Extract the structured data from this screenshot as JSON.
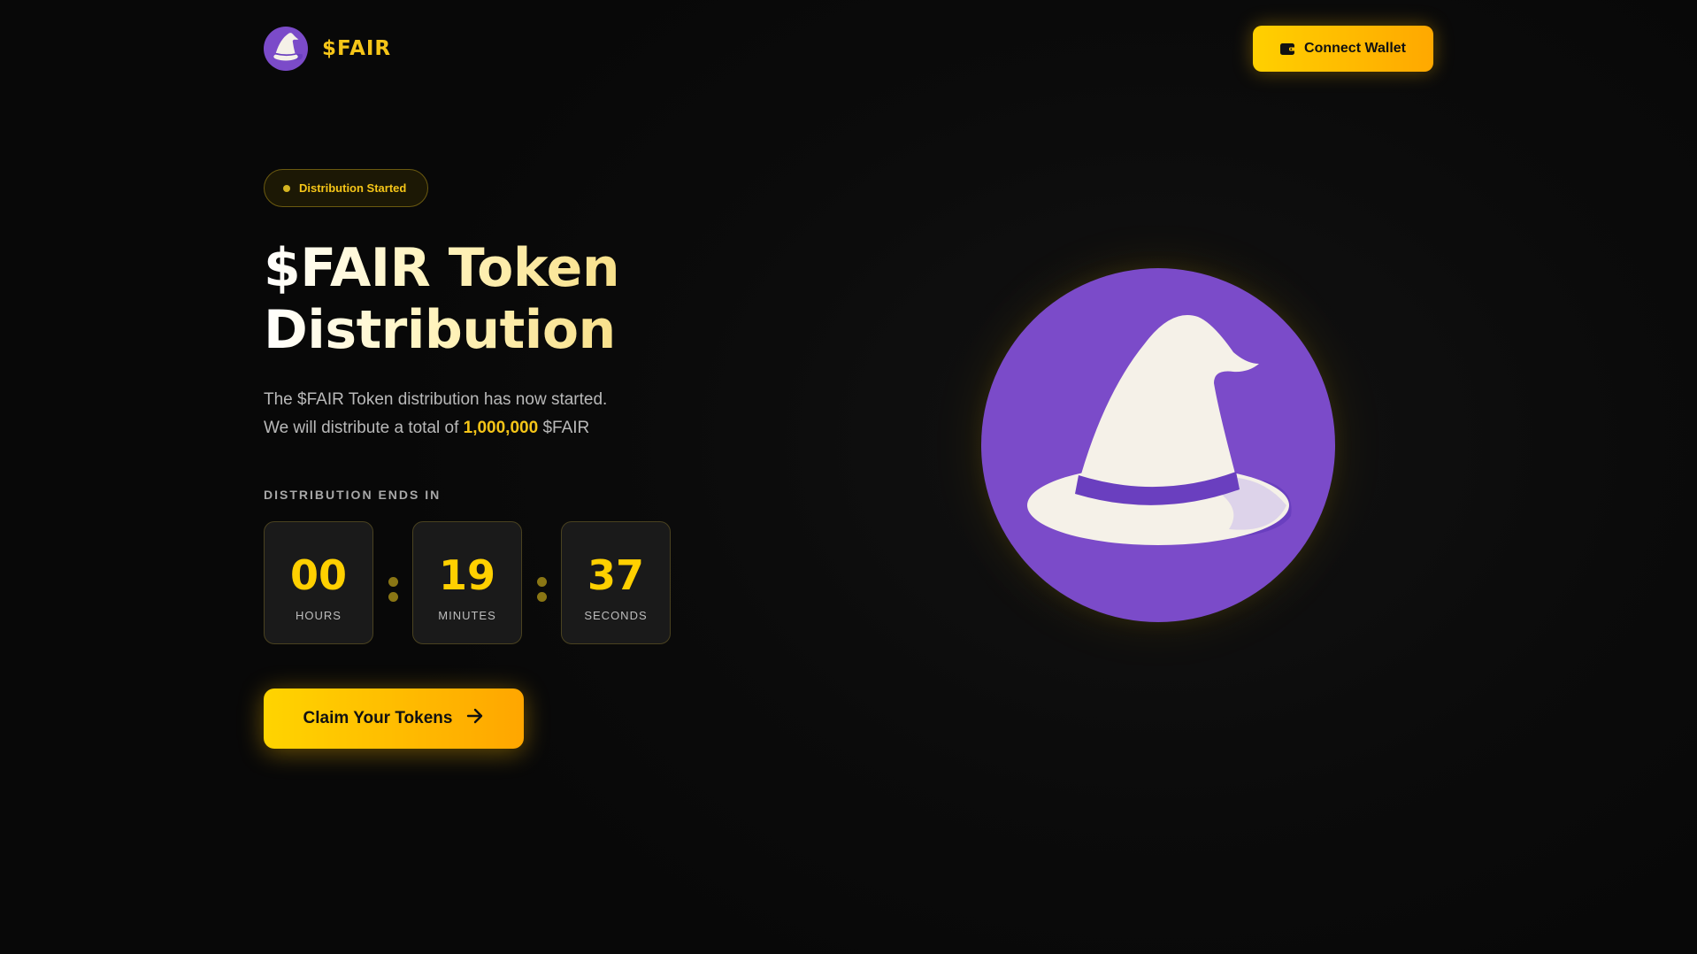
{
  "header": {
    "logo_text": "$FAIR",
    "connect_label": "Connect Wallet",
    "connect_icon": "wallet-icon"
  },
  "hero": {
    "badge": "Distribution Started",
    "title_line1": "$FAIR Token",
    "title_line2": "Distribution",
    "desc_line1": "The $FAIR Token distribution has now started.",
    "desc_line2_prefix": "We will distribute a total of",
    "desc_amount": "1,000,000",
    "desc_suffix": "$FAIR",
    "art_icon": "wizard-hat-icon"
  },
  "countdown": {
    "label": "DISTRIBUTION ENDS IN",
    "hours": "00",
    "hours_label": "HOURS",
    "minutes": "19",
    "minutes_label": "MINUTES",
    "seconds": "37",
    "seconds_label": "SECONDS"
  },
  "cta": {
    "claim_label": "Claim Your Tokens",
    "claim_icon": "arrow-right-icon"
  },
  "colors": {
    "background": "#0b0b0b",
    "accent_yellow": "#ffd000",
    "accent_orange": "#ffa800",
    "brand_purple": "#7b4bc9",
    "hat_white": "#f5f1e8"
  }
}
